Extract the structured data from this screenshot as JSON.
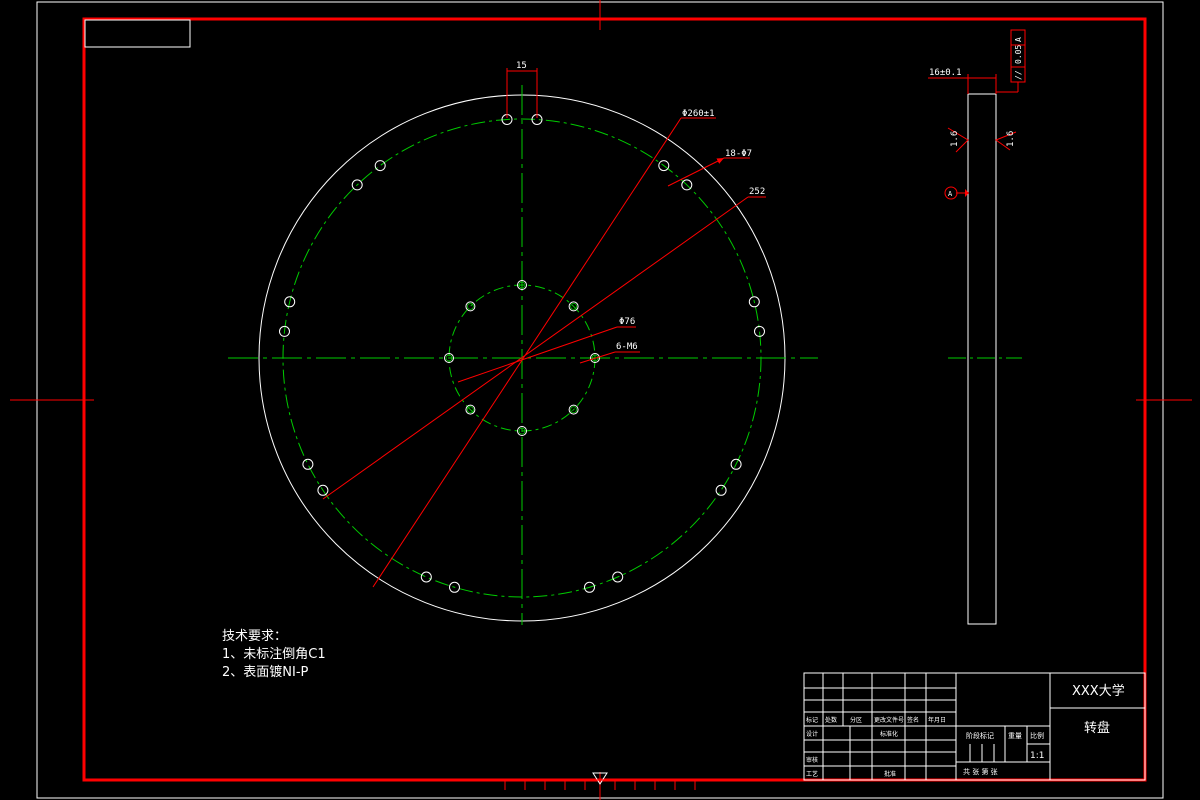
{
  "colors": {
    "background": "#000000",
    "frame": "#ff0000",
    "outline": "#ffffff",
    "centerline": "#00cc00",
    "dimension": "#ff0000",
    "text": "#ffffff"
  },
  "front_view": {
    "outer_diameter_label": "Φ260±1",
    "outer_holes_label": "18-Φ7",
    "bolt_circle_label": "252",
    "inner_circle_label": "Φ76",
    "inner_holes_label": "6-M6",
    "top_spacing_label": "15"
  },
  "side_view": {
    "thickness_label": "16±0.1",
    "roughness_left": "1.6",
    "roughness_right": "1.6",
    "datum_label": "A",
    "tolerance_symbol": "//",
    "tolerance_value": "0.05",
    "tolerance_datum": "A"
  },
  "notes": {
    "title": "技术要求：",
    "line1": "1、未标注倒角C1",
    "line2": "2、表面镀NI-P"
  },
  "title_block": {
    "school": "XXX大学",
    "part_name": "转盘",
    "scale_label": "比例",
    "scale": "1:1",
    "weight_label": "重量",
    "stage_label": "阶段标记",
    "sheets": "共 张 第 张",
    "row_headers": [
      "标记",
      "处数",
      "分区",
      "更改文件号",
      "签名",
      "年月日"
    ],
    "design": "设计",
    "standardize": "标准化",
    "review": "审核",
    "process": "工艺",
    "approve": "批准"
  }
}
